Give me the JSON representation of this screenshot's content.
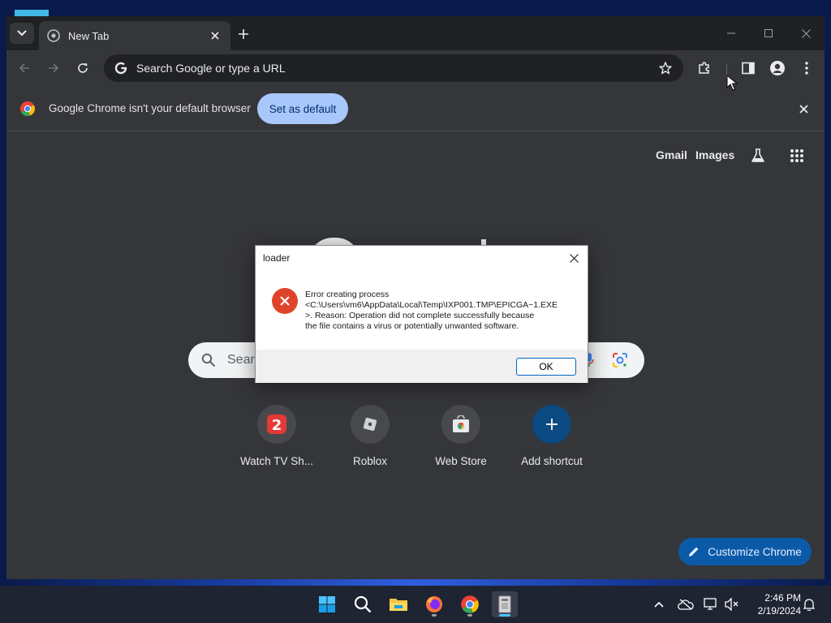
{
  "browser": {
    "tab": {
      "title": "New Tab"
    },
    "omnibox": {
      "placeholder": "Search Google or type a URL"
    },
    "infobar": {
      "message": "Google Chrome isn't your default browser",
      "button": "Set as default"
    }
  },
  "ntp": {
    "links": [
      "Gmail",
      "Images"
    ],
    "search_placeholder": "Sear",
    "shortcuts": [
      {
        "label": "Watch TV Sh...",
        "icon": "tv-app-icon"
      },
      {
        "label": "Roblox",
        "icon": "roblox-icon"
      },
      {
        "label": "Web Store",
        "icon": "web-store-icon"
      },
      {
        "label": "Add shortcut",
        "icon": "plus-icon"
      }
    ],
    "customize_button": "Customize Chrome"
  },
  "dialog": {
    "title": "loader",
    "message_lines": [
      "Error creating process",
      "<C:\\Users\\vm6\\AppData\\Local\\Temp\\IXP001.TMP\\EPICGA~1.EXE",
      ">.  Reason: Operation did not complete successfully because",
      "the file contains a virus or potentially unwanted software."
    ],
    "ok_button": "OK"
  },
  "taskbar": {
    "apps": [
      "windows-start",
      "search",
      "file-explorer",
      "firefox",
      "chrome",
      "loader"
    ],
    "clock": {
      "time": "2:46 PM",
      "date": "2/19/2024"
    }
  },
  "colors": {
    "chrome_bg": "#35363a",
    "accent_blue": "#a8c7fa",
    "error_red": "#e0432b",
    "customize_blue": "#0b5aa8"
  }
}
